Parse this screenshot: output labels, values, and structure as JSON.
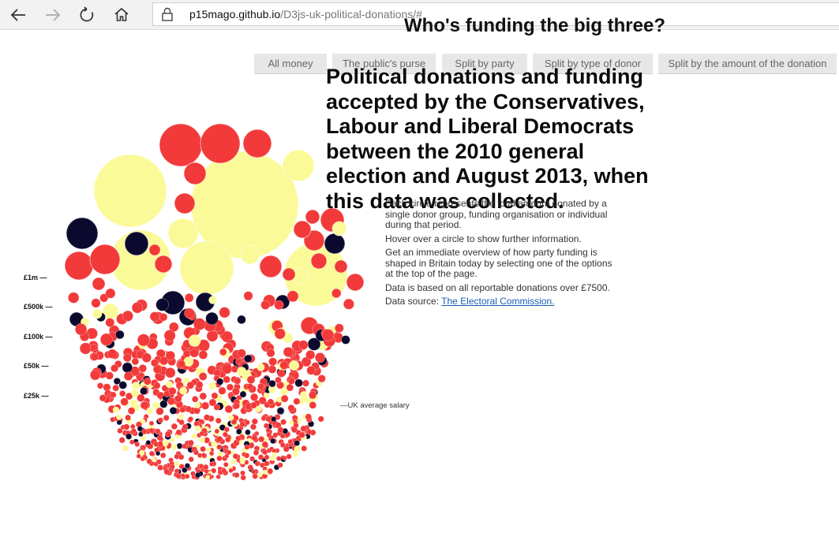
{
  "browser": {
    "url_host": "p15mago.github.io",
    "url_path": "/D3js-uk-political-donations/#",
    "icons": [
      "back-arrow-icon",
      "forward-arrow-icon",
      "refresh-icon",
      "home-icon",
      "lock-icon"
    ]
  },
  "page": {
    "title": "Who's funding the big three?",
    "tabs": [
      {
        "label": "All money"
      },
      {
        "label": "The public's purse"
      },
      {
        "label": "Split by party"
      },
      {
        "label": "Split by type of donor"
      },
      {
        "label": "Split by the amount of the donation"
      }
    ],
    "headline": "Political donations and funding accepted by the Conservatives, Labour and Liberal Democrats between the 2010 general election and August 2013, when this data was collected.",
    "description": [
      "Each circle represents the total amount donated by a single donor group, funding organisation or individual during that period.",
      "Hover over a circle to show further information.",
      "Get an immediate overview of how party funding is shaped in Britain today by selecting one of the options at the top of the page.",
      "Data is based on all reportable donations over £7500."
    ],
    "source_prefix": "Data source: ",
    "source_link": "The Electoral Commission."
  },
  "chart_data": {
    "type": "bubble",
    "axis_labels": [
      "£1m —",
      "£500k —",
      "£100k —",
      "£50k —",
      "£25k —"
    ],
    "reference_line": "—UK average salary",
    "colors": {
      "red": "#f23a3a",
      "yellow": "#fbfa98",
      "navy": "#0b0a2e"
    }
  }
}
